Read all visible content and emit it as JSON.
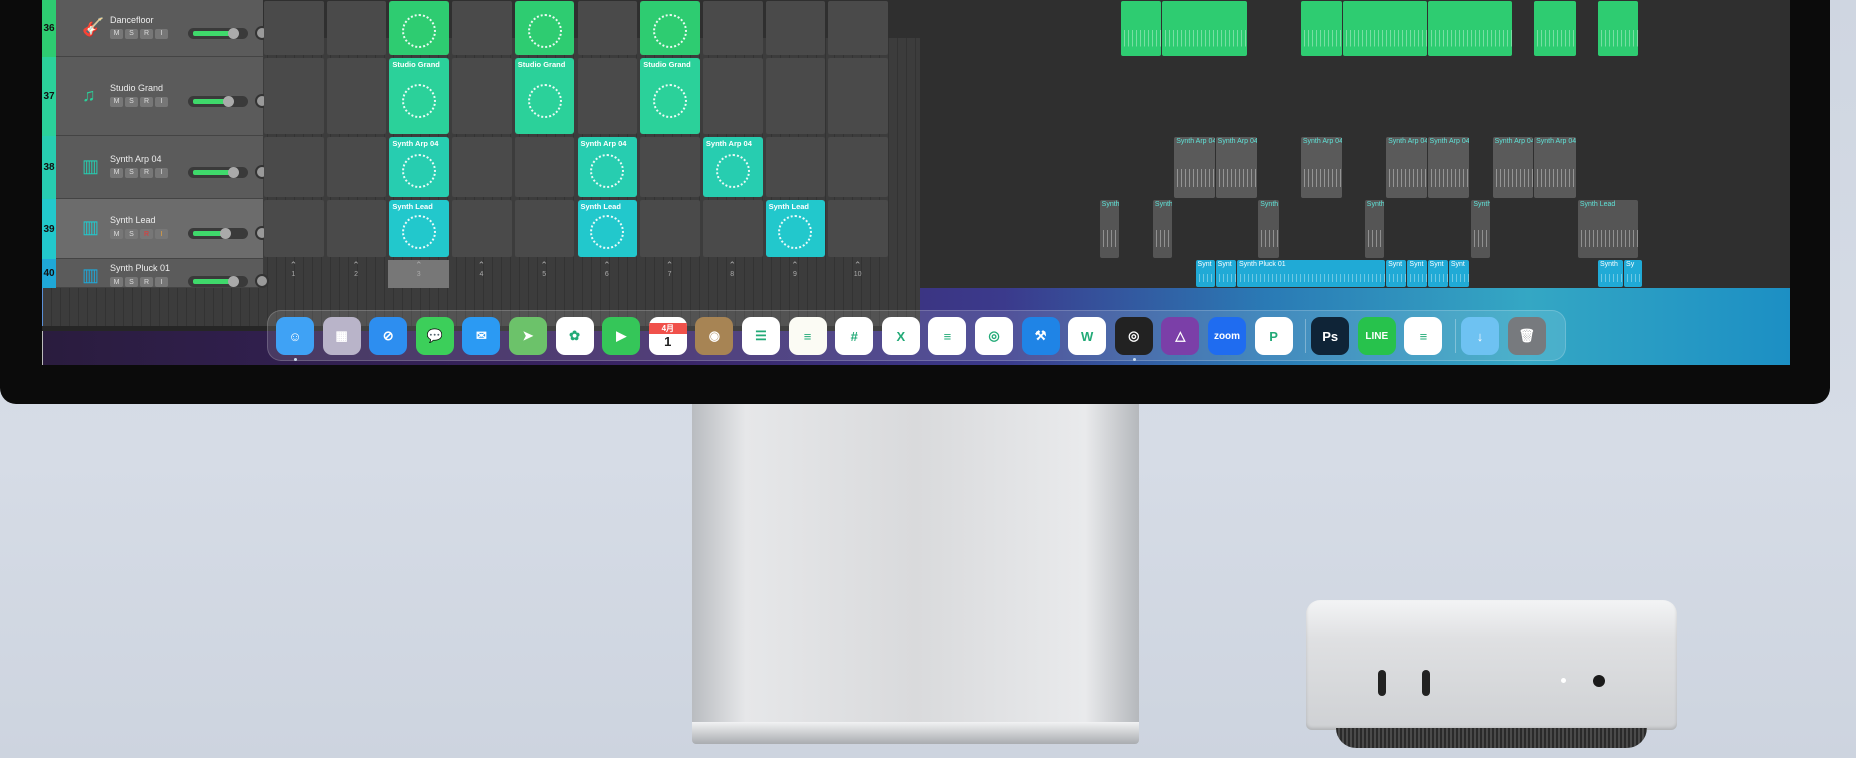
{
  "tracks": [
    {
      "num": "36",
      "name": "Dancefloor",
      "icon": "guitar-icon",
      "color": "#2ecc71",
      "buttons": [
        "M",
        "S",
        "R",
        "I"
      ],
      "volume": 0.85
    },
    {
      "num": "37",
      "name": "Studio Grand",
      "icon": "grand-piano-icon",
      "color": "#2bd19a",
      "buttons": [
        "M",
        "S",
        "R",
        "I"
      ],
      "volume": 0.75
    },
    {
      "num": "38",
      "name": "Synth Arp 04",
      "icon": "synth-keyboard-icon",
      "color": "#27cdb0",
      "buttons": [
        "M",
        "S",
        "R",
        "I"
      ],
      "volume": 0.85
    },
    {
      "num": "39",
      "name": "Synth Lead",
      "icon": "synth-keyboard-icon",
      "color": "#22c8cc",
      "buttons": [
        "M",
        "S",
        "R",
        "I"
      ],
      "volume": 0.7,
      "selected": true
    },
    {
      "num": "40",
      "name": "Synth Pluck 01",
      "icon": "synth-keyboard-icon",
      "color": "#1fa8d8",
      "buttons": [
        "M",
        "S",
        "R",
        "I"
      ],
      "volume": 0.85
    }
  ],
  "live_loops": {
    "scenes": [
      "1",
      "2",
      "3",
      "4",
      "5",
      "6",
      "7",
      "8",
      "9",
      "10"
    ],
    "rows": [
      {
        "cells": [
          {
            "col": 3,
            "label": ""
          },
          {
            "col": 5,
            "label": ""
          },
          {
            "col": 7,
            "label": ""
          }
        ],
        "color": "#2ecc71"
      },
      {
        "cells": [
          {
            "col": 3,
            "label": "Studio Grand"
          },
          {
            "col": 5,
            "label": "Studio Grand"
          },
          {
            "col": 7,
            "label": "Studio Grand"
          }
        ],
        "color": "#2bd19a"
      },
      {
        "cells": [
          {
            "col": 3,
            "label": "Synth Arp 04"
          },
          {
            "col": 6,
            "label": "Synth Arp 04"
          },
          {
            "col": 8,
            "label": "Synth Arp 04"
          }
        ],
        "color": "#27cdb0"
      },
      {
        "cells": [
          {
            "col": 3,
            "label": "Synth Lead"
          },
          {
            "col": 6,
            "label": "Synth Lead"
          },
          {
            "col": 9,
            "label": "Synth Lead"
          }
        ],
        "color": "#22c8cc"
      }
    ]
  },
  "timeline": {
    "rows": [
      {
        "color": "#2ecc71",
        "text": "#ffffff",
        "labels": [
          "",
          "",
          "",
          "",
          "",
          "",
          ""
        ]
      },
      {
        "color": "",
        "text": "",
        "labels": []
      },
      {
        "color": "#5a5a5a",
        "text": "#5fe3d8",
        "labels": [
          "Synth Arp 04",
          "Synth Arp 04",
          "Synth Arp 04",
          "Synth Arp 04",
          "Synth Arp 04",
          "Synth Arp 04",
          "Synth Arp 04"
        ]
      },
      {
        "color": "#555555",
        "text": "#5fe3d8",
        "labels": [
          "Synth",
          "Synth",
          "Synth",
          "Synth",
          "Synth",
          "Synth Lead"
        ]
      },
      {
        "color": "#20aad6",
        "text": "#ffffff",
        "labels": [
          "Synt",
          "Synt",
          "Synth Pluck 01",
          "Synt",
          "Synt",
          "Synt",
          "Synt",
          "Synth",
          "Sy"
        ]
      }
    ]
  },
  "dock": {
    "apps": [
      {
        "icon": "finder-icon",
        "bg": "#3fa2f5",
        "glyph": "☺",
        "running": true
      },
      {
        "icon": "launchpad-icon",
        "bg": "#b9b4c9",
        "glyph": "▦"
      },
      {
        "icon": "safari-icon",
        "bg": "#2d8ef0",
        "glyph": "⊘"
      },
      {
        "icon": "messages-icon",
        "bg": "#3ccf5a",
        "glyph": "💬"
      },
      {
        "icon": "mail-icon",
        "bg": "#2b9af3",
        "glyph": "✉"
      },
      {
        "icon": "maps-icon",
        "bg": "#6cc26a",
        "glyph": "➤"
      },
      {
        "icon": "photos-icon",
        "bg": "#ffffff",
        "glyph": "✿"
      },
      {
        "icon": "facetime-icon",
        "bg": "#35c659",
        "glyph": "▶"
      },
      {
        "icon": "calendar-icon",
        "bg": "#ffffff",
        "glyph": "1",
        "month": "4月"
      },
      {
        "icon": "contacts-icon",
        "bg": "#a78454",
        "glyph": "◉"
      },
      {
        "icon": "reminders-icon",
        "bg": "#ffffff",
        "glyph": "☰"
      },
      {
        "icon": "notes-icon",
        "bg": "#fbfbf4",
        "glyph": "≡"
      },
      {
        "icon": "slack-icon",
        "bg": "#ffffff",
        "glyph": "#"
      },
      {
        "icon": "excel-icon",
        "bg": "#ffffff",
        "glyph": "X"
      },
      {
        "icon": "speeko-icon",
        "bg": "#ffffff",
        "glyph": "≡"
      },
      {
        "icon": "chrome-icon",
        "bg": "#ffffff",
        "glyph": "◎"
      },
      {
        "icon": "xcode-icon",
        "bg": "#1f84e6",
        "glyph": "⚒"
      },
      {
        "icon": "word-icon",
        "bg": "#ffffff",
        "glyph": "W"
      },
      {
        "icon": "logic-pro-icon",
        "bg": "#222222",
        "glyph": "◎",
        "running": true
      },
      {
        "icon": "affinity-photo-icon",
        "bg": "#7b3fa8",
        "glyph": "△"
      },
      {
        "icon": "zoom-icon",
        "bg": "#1f6cf0",
        "glyph": "zoom"
      },
      {
        "icon": "powerpoint-icon",
        "bg": "#ffffff",
        "glyph": "P"
      },
      {
        "icon": "photoshop-icon",
        "bg": "#0f2437",
        "glyph": "Ps"
      },
      {
        "icon": "line-icon",
        "bg": "#27c24c",
        "glyph": "LINE"
      },
      {
        "icon": "google-docs-icon",
        "bg": "#ffffff",
        "glyph": "≡"
      },
      {
        "icon": "downloads-folder-icon",
        "bg": "#6ec2f2",
        "glyph": "↓"
      },
      {
        "icon": "trash-icon",
        "bg": "#777a7e",
        "glyph": "🗑"
      }
    ]
  }
}
